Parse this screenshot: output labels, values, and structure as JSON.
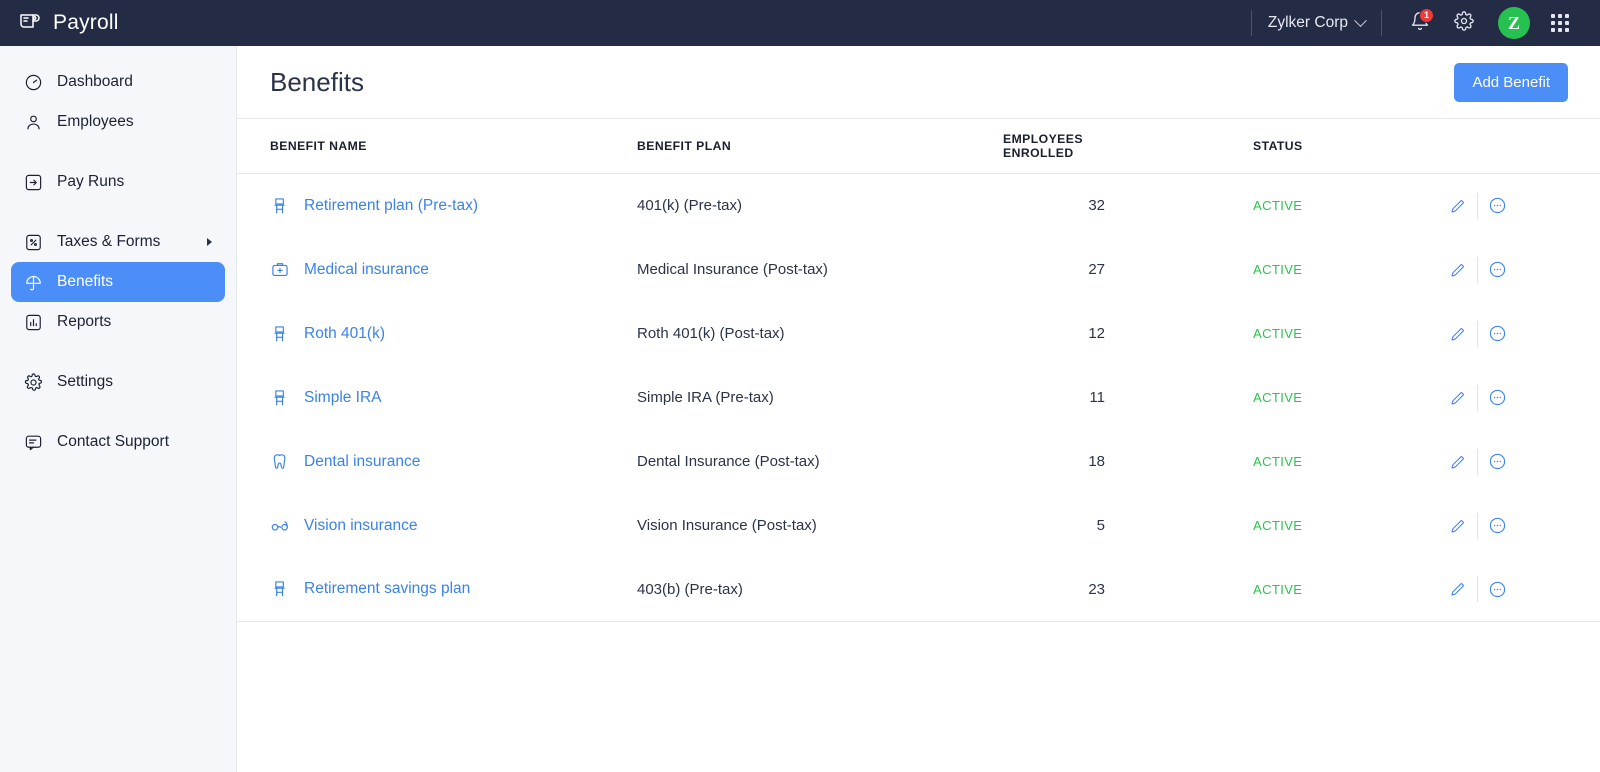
{
  "topbar": {
    "logo_icon": "payroll-logo-icon",
    "brand": "Payroll",
    "org_name": "Zylker Corp",
    "org_chevron_icon": "chevron-down-icon",
    "notifications_icon": "bell-icon",
    "notifications_count": "1",
    "settings_icon": "gear-icon",
    "avatar_initial": "Z",
    "apps_icon": "apps-grid-icon",
    "colors": {
      "bar_bg": "#232b45",
      "avatar_bg": "#27c152",
      "badge_bg": "#ef3b38"
    }
  },
  "sidebar": {
    "items": [
      {
        "label": "Dashboard",
        "icon": "dashboard-gauge-icon",
        "active": false,
        "has_submenu": false
      },
      {
        "label": "Employees",
        "icon": "person-icon",
        "active": false,
        "has_submenu": false
      },
      {
        "label": "Pay Runs",
        "icon": "pay-run-icon",
        "active": false,
        "has_submenu": false
      },
      {
        "label": "Taxes & Forms",
        "icon": "tax-percent-icon",
        "active": false,
        "has_submenu": true
      },
      {
        "label": "Benefits",
        "icon": "umbrella-icon",
        "active": true,
        "has_submenu": false
      },
      {
        "label": "Reports",
        "icon": "bar-chart-icon",
        "active": false,
        "has_submenu": false
      },
      {
        "label": "Settings",
        "icon": "gear-icon",
        "active": false,
        "has_submenu": false
      },
      {
        "label": "Contact Support",
        "icon": "chat-message-icon",
        "active": false,
        "has_submenu": false
      }
    ],
    "active_color": "#4c8ef7"
  },
  "page": {
    "title": "Benefits",
    "add_button": "Add Benefit",
    "accent_color": "#4c8ef7"
  },
  "table": {
    "columns": [
      "BENEFIT NAME",
      "BENEFIT PLAN",
      "EMPLOYEES ENROLLED",
      "STATUS"
    ],
    "row_actions": {
      "edit_icon": "pencil-icon",
      "more_icon": "more-circle-icon"
    },
    "status_color": "#2fc04d",
    "link_color": "#3b82e8",
    "rows": [
      {
        "name": "Retirement plan (Pre-tax)",
        "icon": "retirement-chair-icon",
        "plan": "401(k) (Pre-tax)",
        "enrolled": "32",
        "status": "ACTIVE"
      },
      {
        "name": "Medical insurance",
        "icon": "medical-kit-icon",
        "plan": "Medical Insurance (Post-tax)",
        "enrolled": "27",
        "status": "ACTIVE"
      },
      {
        "name": "Roth 401(k)",
        "icon": "retirement-chair-icon",
        "plan": "Roth 401(k) (Post-tax)",
        "enrolled": "12",
        "status": "ACTIVE"
      },
      {
        "name": "Simple IRA",
        "icon": "retirement-chair-icon",
        "plan": "Simple IRA (Pre-tax)",
        "enrolled": "11",
        "status": "ACTIVE"
      },
      {
        "name": "Dental insurance",
        "icon": "tooth-icon",
        "plan": "Dental Insurance (Post-tax)",
        "enrolled": "18",
        "status": "ACTIVE"
      },
      {
        "name": "Vision insurance",
        "icon": "eyeglasses-icon",
        "plan": "Vision Insurance (Post-tax)",
        "enrolled": "5",
        "status": "ACTIVE"
      },
      {
        "name": "Retirement savings plan",
        "icon": "retirement-chair-icon",
        "plan": "403(b) (Pre-tax)",
        "enrolled": "23",
        "status": "ACTIVE"
      }
    ]
  }
}
